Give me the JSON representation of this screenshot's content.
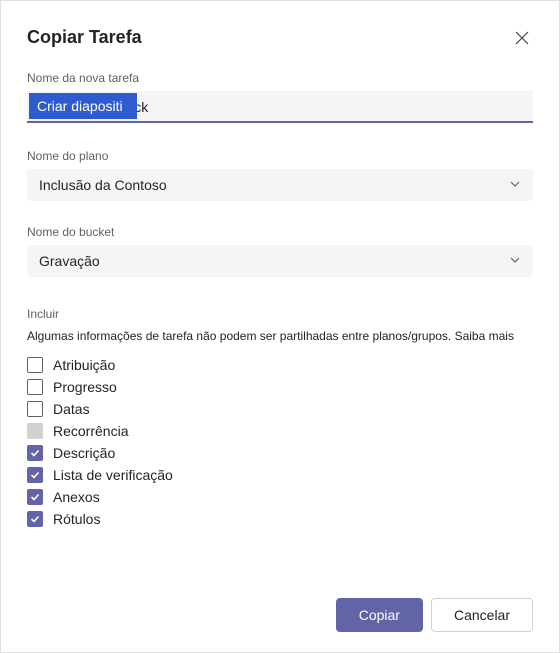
{
  "dialog": {
    "title": "Copiar Tarefa",
    "taskNameLabel": "Nome da nova tarefa",
    "taskNameValue": "Criar diapositi eck",
    "taskNameSelected": "Criar diapositi",
    "planLabel": "Nome do plano",
    "planValue": "Inclusão da Contoso",
    "bucketLabel": "Nome do bucket",
    "bucketValue": "Gravação",
    "includeLabel": "Incluir",
    "includeHelper": "Algumas informações de tarefa não podem ser partilhadas entre planos/grupos. Saiba mais",
    "options": [
      {
        "label": "Atribuição",
        "checked": false,
        "disabled": false
      },
      {
        "label": "Progresso",
        "checked": false,
        "disabled": false
      },
      {
        "label": "Datas",
        "checked": false,
        "disabled": false
      },
      {
        "label": "Recorrência",
        "checked": false,
        "disabled": true
      },
      {
        "label": "Descrição",
        "checked": true,
        "disabled": false
      },
      {
        "label": "Lista de verificação",
        "checked": true,
        "disabled": false
      },
      {
        "label": "Anexos",
        "checked": true,
        "disabled": false
      },
      {
        "label": "Rótulos",
        "checked": true,
        "disabled": false
      }
    ],
    "primaryButton": "Copiar",
    "secondaryButton": "Cancelar"
  },
  "colors": {
    "accent": "#6264a7",
    "selection": "#2f5bd0"
  }
}
